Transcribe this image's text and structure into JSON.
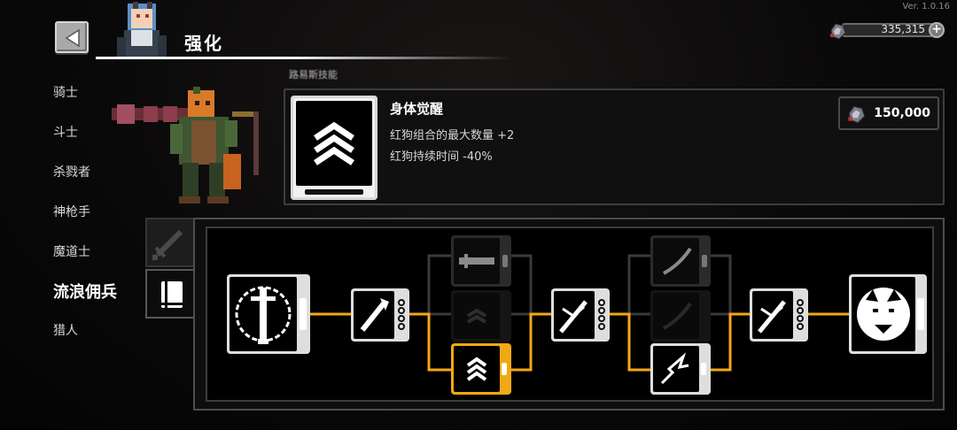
{
  "version": "Ver. 1.0.16",
  "title": "强化",
  "currency": {
    "amount": "335,315",
    "icon": "gem-ore-icon",
    "add_icon": "plus-icon"
  },
  "classes": [
    {
      "label": "骑士",
      "active": false
    },
    {
      "label": "斗士",
      "active": false
    },
    {
      "label": "杀戮者",
      "active": false
    },
    {
      "label": "神枪手",
      "active": false
    },
    {
      "label": "魔道士",
      "active": false
    },
    {
      "label": "流浪佣兵",
      "active": true
    },
    {
      "label": "猎人",
      "active": false
    }
  ],
  "detail": {
    "header_blurred": "路易斯技能",
    "icon": "triple-chevron-up-icon",
    "name": "身体觉醒",
    "effects": [
      "红狗组合的最大数量 +2",
      "红狗持续时间 -40%"
    ],
    "cost": "150,000"
  },
  "tabs": [
    {
      "icon": "sword-icon",
      "active": false
    },
    {
      "icon": "book-icon",
      "active": true
    }
  ],
  "tree": {
    "nodes": [
      {
        "id": "root",
        "icon": "sword-ring-icon",
        "state": "owned"
      },
      {
        "id": "n1",
        "icon": "flame-sword-icon",
        "state": "owned"
      },
      {
        "id": "n2a",
        "icon": "broad-blade-icon",
        "state": "locked"
      },
      {
        "id": "n2b",
        "icon": "triple-chevron-up-icon",
        "state": "hidden"
      },
      {
        "id": "n2c",
        "icon": "triple-chevron-up-icon",
        "state": "selected"
      },
      {
        "id": "n3",
        "icon": "slash-strike-icon",
        "state": "owned"
      },
      {
        "id": "n4a",
        "icon": "curved-blade-icon",
        "state": "locked"
      },
      {
        "id": "n4b",
        "icon": "curved-blade-icon",
        "state": "hidden"
      },
      {
        "id": "n4c",
        "icon": "lightning-slash-icon",
        "state": "owned"
      },
      {
        "id": "n5",
        "icon": "slash-strike-icon",
        "state": "owned"
      },
      {
        "id": "final",
        "icon": "wolf-head-icon",
        "state": "owned"
      }
    ]
  },
  "colors": {
    "accent": "#f2a814",
    "panel": "#101010",
    "line_inactive": "#3a3a3a"
  }
}
